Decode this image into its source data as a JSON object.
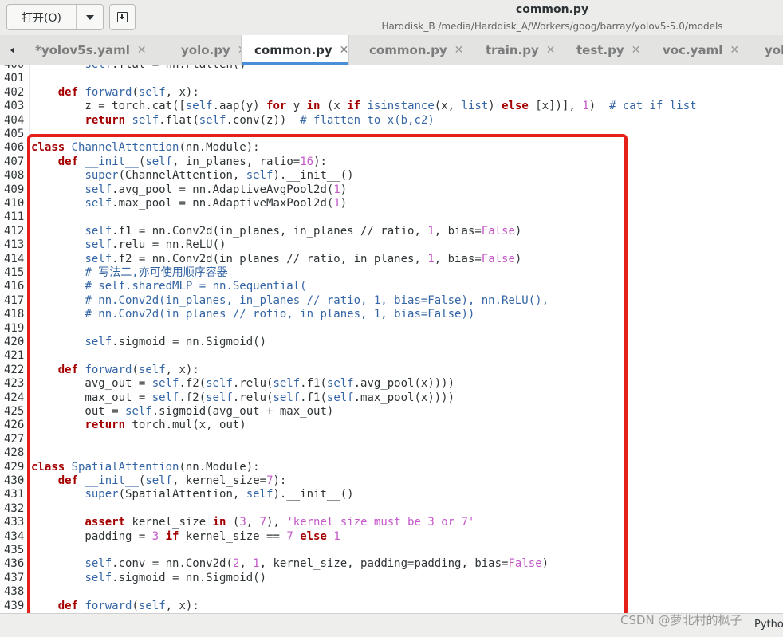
{
  "header": {
    "open_label": "打开(O)",
    "title": "common.py",
    "subtitle": "Harddisk_B /media/Harddisk_A/Workers/goog/barray/yolov5-5.0/models"
  },
  "tabs": [
    {
      "label": "*yolov5s.yaml",
      "active": false
    },
    {
      "label": "yolo.py",
      "active": false
    },
    {
      "label": "common.py",
      "active": true
    },
    {
      "label": "common.py",
      "active": false
    },
    {
      "label": "train.py",
      "active": false
    },
    {
      "label": "test.py",
      "active": false
    },
    {
      "label": "voc.yaml",
      "active": false
    },
    {
      "label": "yolo",
      "active": false
    }
  ],
  "tab_close_glyph": "✕",
  "editor": {
    "lines": [
      {
        "n": "400",
        "code": "        self.flat = nn.Flatten()"
      },
      {
        "n": "401",
        "code": ""
      },
      {
        "n": "402",
        "code": "    def forward(self, x):"
      },
      {
        "n": "403",
        "code": "        z = torch.cat([self.aap(y) for y in (x if isinstance(x, list) else [x])], 1)  # cat if list"
      },
      {
        "n": "404",
        "code": "        return self.flat(self.conv(z))  # flatten to x(b,c2)"
      },
      {
        "n": "405",
        "code": ""
      },
      {
        "n": "406",
        "code": "class ChannelAttention(nn.Module):"
      },
      {
        "n": "407",
        "code": "    def __init__(self, in_planes, ratio=16):"
      },
      {
        "n": "408",
        "code": "        super(ChannelAttention, self).__init__()"
      },
      {
        "n": "409",
        "code": "        self.avg_pool = nn.AdaptiveAvgPool2d(1)"
      },
      {
        "n": "410",
        "code": "        self.max_pool = nn.AdaptiveMaxPool2d(1)"
      },
      {
        "n": "411",
        "code": ""
      },
      {
        "n": "412",
        "code": "        self.f1 = nn.Conv2d(in_planes, in_planes // ratio, 1, bias=False)"
      },
      {
        "n": "413",
        "code": "        self.relu = nn.ReLU()"
      },
      {
        "n": "414",
        "code": "        self.f2 = nn.Conv2d(in_planes // ratio, in_planes, 1, bias=False)"
      },
      {
        "n": "415",
        "code": "        # 写法二,亦可使用顺序容器"
      },
      {
        "n": "416",
        "code": "        # self.sharedMLP = nn.Sequential("
      },
      {
        "n": "417",
        "code": "        # nn.Conv2d(in_planes, in_planes // ratio, 1, bias=False), nn.ReLU(),"
      },
      {
        "n": "418",
        "code": "        # nn.Conv2d(in_planes // rotio, in_planes, 1, bias=False))"
      },
      {
        "n": "419",
        "code": ""
      },
      {
        "n": "420",
        "code": "        self.sigmoid = nn.Sigmoid()"
      },
      {
        "n": "421",
        "code": ""
      },
      {
        "n": "422",
        "code": "    def forward(self, x):"
      },
      {
        "n": "423",
        "code": "        avg_out = self.f2(self.relu(self.f1(self.avg_pool(x))))"
      },
      {
        "n": "424",
        "code": "        max_out = self.f2(self.relu(self.f1(self.max_pool(x))))"
      },
      {
        "n": "425",
        "code": "        out = self.sigmoid(avg_out + max_out)"
      },
      {
        "n": "426",
        "code": "        return torch.mul(x, out)"
      },
      {
        "n": "427",
        "code": ""
      },
      {
        "n": "428",
        "code": ""
      },
      {
        "n": "429",
        "code": "class SpatialAttention(nn.Module):"
      },
      {
        "n": "430",
        "code": "    def __init__(self, kernel_size=7):"
      },
      {
        "n": "431",
        "code": "        super(SpatialAttention, self).__init__()"
      },
      {
        "n": "432",
        "code": ""
      },
      {
        "n": "433",
        "code": "        assert kernel_size in (3, 7), 'kernel size must be 3 or 7'"
      },
      {
        "n": "434",
        "code": "        padding = 3 if kernel_size == 7 else 1"
      },
      {
        "n": "435",
        "code": ""
      },
      {
        "n": "436",
        "code": "        self.conv = nn.Conv2d(2, 1, kernel_size, padding=padding, bias=False)"
      },
      {
        "n": "437",
        "code": "        self.sigmoid = nn.Sigmoid()"
      },
      {
        "n": "438",
        "code": ""
      },
      {
        "n": "439",
        "code": "    def forward(self, x):"
      }
    ]
  },
  "statusbar": {
    "language": "Python"
  },
  "watermark": "CSDN @萝北村的枫子"
}
